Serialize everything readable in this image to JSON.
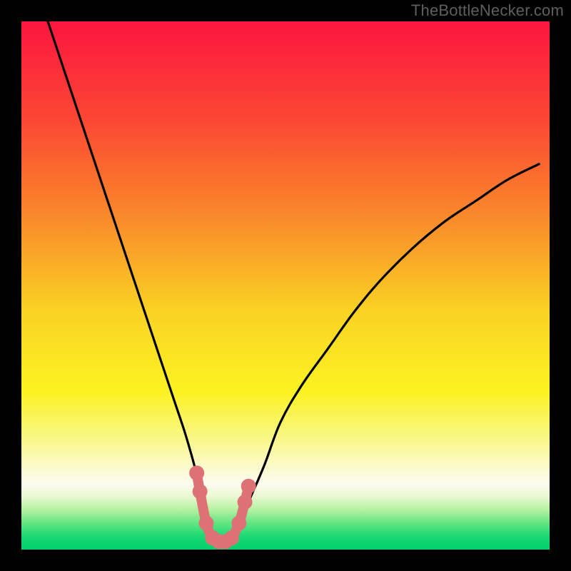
{
  "watermark": "TheBottleNecker.com",
  "colors": {
    "frame_bg": "#000000",
    "curve": "#000000",
    "marker_fill": "#dd7176",
    "marker_stroke": "#dd7176",
    "gradient_stops": [
      {
        "offset": 0.0,
        "color": "#fc163f"
      },
      {
        "offset": 0.18,
        "color": "#fb4534"
      },
      {
        "offset": 0.38,
        "color": "#f98d2a"
      },
      {
        "offset": 0.55,
        "color": "#fad324"
      },
      {
        "offset": 0.7,
        "color": "#fcf221"
      },
      {
        "offset": 0.79,
        "color": "#f9f788"
      },
      {
        "offset": 0.84,
        "color": "#fcfac7"
      },
      {
        "offset": 0.875,
        "color": "#fdfcef"
      },
      {
        "offset": 0.9,
        "color": "#e8f9d1"
      },
      {
        "offset": 0.925,
        "color": "#b3f1a0"
      },
      {
        "offset": 0.95,
        "color": "#62e583"
      },
      {
        "offset": 0.975,
        "color": "#1ad973"
      },
      {
        "offset": 1.0,
        "color": "#00d06c"
      }
    ]
  },
  "chart_data": {
    "type": "line",
    "title": "",
    "xlabel": "",
    "ylabel": "",
    "x_range": [
      0,
      100
    ],
    "y_range": [
      0,
      100
    ],
    "series": [
      {
        "name": "bottleneck-curve",
        "x": [
          5,
          7,
          9,
          11,
          13,
          15,
          17,
          19,
          21,
          23,
          25,
          27,
          29,
          31,
          33,
          34.5,
          36,
          37.5,
          39,
          41,
          43,
          46,
          49,
          53,
          58,
          63,
          68,
          74,
          80,
          86,
          92,
          98
        ],
        "y": [
          100,
          94,
          88,
          82,
          76,
          70,
          64,
          58,
          52,
          46,
          40,
          34,
          28,
          22,
          15,
          9,
          4,
          1.5,
          1.5,
          4,
          9,
          16,
          24,
          31,
          38,
          45,
          51,
          57,
          62,
          66,
          70,
          73
        ]
      }
    ],
    "markers": {
      "name": "highlight-points",
      "x": [
        33.2,
        33.8,
        35.0,
        36.2,
        37.4,
        38.6,
        39.8,
        41.2,
        42.3,
        43.0
      ],
      "y": [
        14.5,
        11.0,
        5.0,
        2.2,
        1.5,
        1.5,
        2.2,
        5.0,
        9.0,
        12.0
      ]
    }
  }
}
